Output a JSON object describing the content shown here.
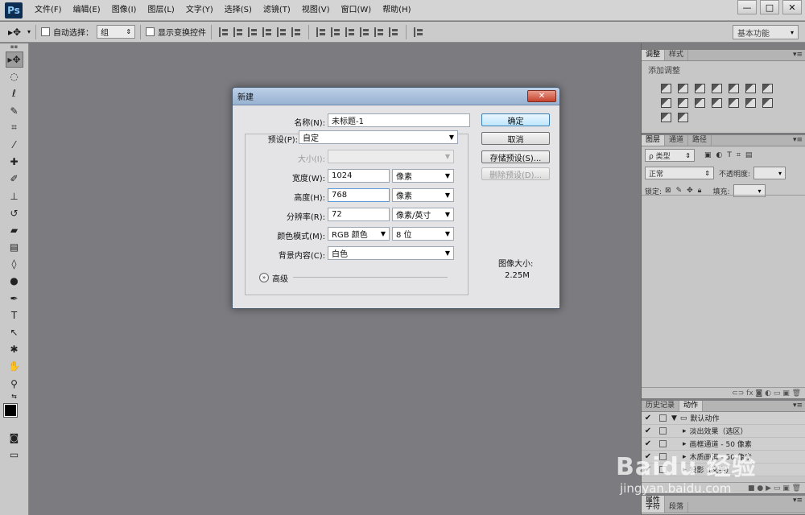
{
  "app": {
    "logo": "Ps"
  },
  "menu": [
    "文件(F)",
    "编辑(E)",
    "图像(I)",
    "图层(L)",
    "文字(Y)",
    "选择(S)",
    "滤镜(T)",
    "视图(V)",
    "窗口(W)",
    "帮助(H)"
  ],
  "window_controls": {
    "minimize": "—",
    "restore": "□",
    "close": "✕"
  },
  "options_bar": {
    "auto_select_label": "自动选择：",
    "auto_select_value": "组",
    "show_transform_label": "显示变换控件",
    "workspace": "基本功能"
  },
  "panels": {
    "top_tabs": [
      "调整",
      "样式"
    ],
    "adjust_title": "添加调整",
    "layers_tabs": [
      "图层",
      "通道",
      "路径"
    ],
    "layers_filter": "ρ 类型",
    "blend_mode": "正常",
    "opacity_label": "不透明度:",
    "lock_label": "锁定:",
    "fill_label": "填充:",
    "history_tabs": [
      "历史记录",
      "动作"
    ],
    "actions": [
      {
        "check": "✔",
        "label": "默认动作",
        "folder": true
      },
      {
        "check": "✔",
        "label": "淡出效果（选区）",
        "folder": false
      },
      {
        "check": "✔",
        "label": "画框通道 - 50 像素",
        "folder": false
      },
      {
        "check": "✔",
        "label": "木质画框 - 50 像素",
        "folder": false
      },
      {
        "check": "✔",
        "label": "投影（文字）",
        "folder": false
      }
    ],
    "bottom_tabs": [
      "属性"
    ],
    "bottom_tabs2": [
      "字符",
      "段落"
    ]
  },
  "dialog": {
    "title": "新建",
    "close": "✕",
    "name_label": "名称(N):",
    "name_value": "未标题-1",
    "preset_label": "预设(P):",
    "preset_value": "自定",
    "size_label": "大小(I):",
    "width_label": "宽度(W):",
    "width_value": "1024",
    "width_unit": "像素",
    "height_label": "高度(H):",
    "height_value": "768",
    "height_unit": "像素",
    "resolution_label": "分辨率(R):",
    "resolution_value": "72",
    "resolution_unit": "像素/英寸",
    "color_mode_label": "颜色模式(M):",
    "color_mode_value": "RGB 颜色",
    "bit_depth": "8 位",
    "bg_label": "背景内容(C):",
    "bg_value": "白色",
    "advanced": "高级",
    "image_size_label": "图像大小:",
    "image_size_value": "2.25M",
    "buttons": {
      "ok": "确定",
      "cancel": "取消",
      "save_preset": "存储预设(S)...",
      "delete_preset": "删除预设(D)..."
    }
  },
  "watermark": {
    "logo": "Baidu 经验",
    "url": "jingyan.baidu.com"
  }
}
